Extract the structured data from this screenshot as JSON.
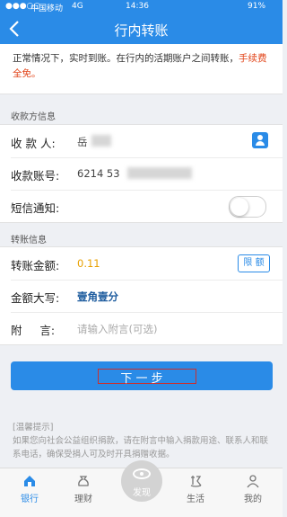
{
  "status_bar": {
    "signal": "●●●○○",
    "carrier": "中国移动",
    "network": "4G",
    "time": "14:36",
    "battery": "91%"
  },
  "nav": {
    "back_icon": "chevron-left-icon",
    "title": "行内转账"
  },
  "notice": {
    "text": "正常情况下，实时到账。在行内的活期账户之间转账，",
    "highlight": "手续费全免。"
  },
  "payee_section": {
    "title": "收款方信息",
    "name_label": "收 款 人:",
    "name_value": "岳",
    "account_label": "收款账号:",
    "account_value": "6214 53",
    "sms_label": "短信通知:",
    "sms_enabled": false
  },
  "transfer_section": {
    "title": "转账信息",
    "amount_label": "转账金额:",
    "amount_value": "0.11",
    "limit_button": "限 额",
    "uppercase_label": "金额大写:",
    "uppercase_value": "壹角壹分",
    "memo_label": "附     言:",
    "memo_placeholder": "请输入附言(可选)"
  },
  "next_button": "下 一 步",
  "tips": {
    "title": "[温馨提示]",
    "text": "如果您向社会公益组织捐款，请在附言中输入捐款用途、联系人和联系电话，确保受捐人可及时开具捐赠收据。"
  },
  "tabbar": {
    "tabs": [
      {
        "label": "银行",
        "icon": "home-icon",
        "active": true
      },
      {
        "label": "理财",
        "icon": "money-bag-icon",
        "active": false
      },
      {
        "label": "发现",
        "icon": "eye-icon",
        "active": false
      },
      {
        "label": "生活",
        "icon": "life-icon",
        "active": false
      },
      {
        "label": "我的",
        "icon": "person-icon",
        "active": false
      }
    ]
  },
  "colors": {
    "primary": "#2a8be7",
    "highlight": "#e2461b",
    "amount": "#e8a000"
  }
}
